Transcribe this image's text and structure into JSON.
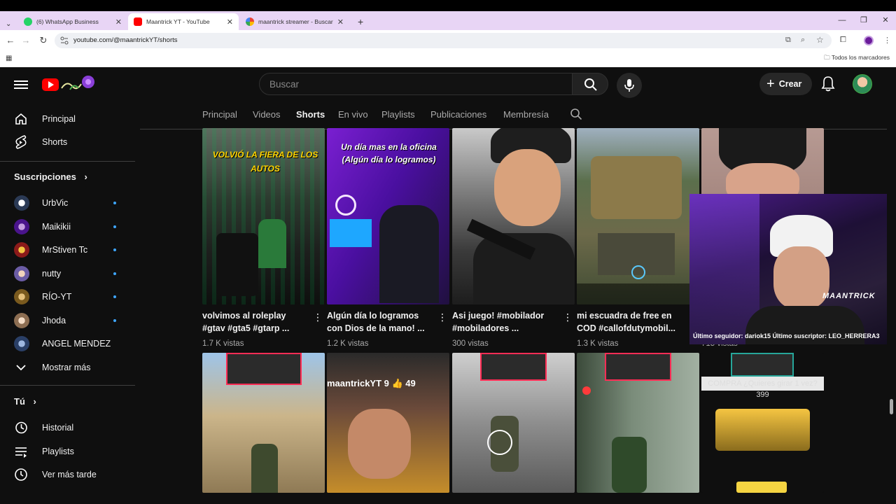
{
  "browser": {
    "tabs": [
      {
        "title": "(6) WhatsApp Business",
        "favicon_color": "#25d366"
      },
      {
        "title": "Maantrick YT - YouTube",
        "favicon_color": "#ff0000"
      },
      {
        "title": "maantrick streamer - Buscar con Google",
        "favicon_color": "#4285f4"
      }
    ],
    "url": "youtube.com/@maantrickYT/shorts",
    "bookmarks_label": "Todos los marcadores"
  },
  "youtube": {
    "search_placeholder": "Buscar",
    "create_label": "Crear",
    "sidebar": {
      "main_items": [
        {
          "label": "Principal",
          "icon": "home-icon"
        },
        {
          "label": "Shorts",
          "icon": "shorts-icon"
        }
      ],
      "subscriptions_heading": "Suscripciones",
      "subscriptions": [
        {
          "label": "UrbVic",
          "color": "#dfe6f0"
        },
        {
          "label": "Maikikii",
          "color": "#7b2cbf"
        },
        {
          "label": "MrStiven Tc",
          "color": "#c0392b"
        },
        {
          "label": "nutty",
          "color": "#8e7cc3"
        },
        {
          "label": "RÍO-YT",
          "color": "#b8860b"
        },
        {
          "label": "Jhoda",
          "color": "#c9a27e"
        },
        {
          "label": "ANGEL MENDEZ",
          "color": "#3a5fa0"
        }
      ],
      "show_more": "Mostrar más",
      "you_heading": "Tú",
      "you_items": [
        {
          "label": "Historial",
          "icon": "history-icon"
        },
        {
          "label": "Playlists",
          "icon": "playlists-icon"
        },
        {
          "label": "Ver más tarde",
          "icon": "watch-later-icon"
        }
      ]
    },
    "channel_tabs": [
      "Principal",
      "Videos",
      "Shorts",
      "En vivo",
      "Playlists",
      "Publicaciones",
      "Membresía"
    ],
    "active_tab": "Shorts",
    "shorts_row1": [
      {
        "title": "volvimos al roleplay #gtav #gta5 #gtarp ...",
        "views": "1.7 K vistas",
        "overlay": "VOLVIÓ LA FIERA DE LOS AUTOS"
      },
      {
        "title": "Algún día lo logramos con Dios de la mano! ...",
        "views": "1.2 K vistas",
        "overlay": "Un día mas en la oficina (Algún día lo logramos)"
      },
      {
        "title": "Asi juego! #mobilador #mobiladores ...",
        "views": "300 vistas",
        "overlay": ""
      },
      {
        "title": "mi escuadra de free en COD #callofdutymobil...",
        "views": "1.3 K vistas",
        "overlay": ""
      },
      {
        "title": "",
        "views": "715 vistas",
        "overlay": ""
      }
    ],
    "shorts_row2_overlays": [
      "",
      "maantrickYT 9 👍 49",
      "",
      "",
      "COMPRA ¿Quieres girar 1 vez? 399"
    ],
    "stream_overlay": {
      "ticker": "Último seguidor: dariok15 Último suscriptor: LEO_HERRERA3",
      "brand": "MAANTRICK"
    }
  }
}
